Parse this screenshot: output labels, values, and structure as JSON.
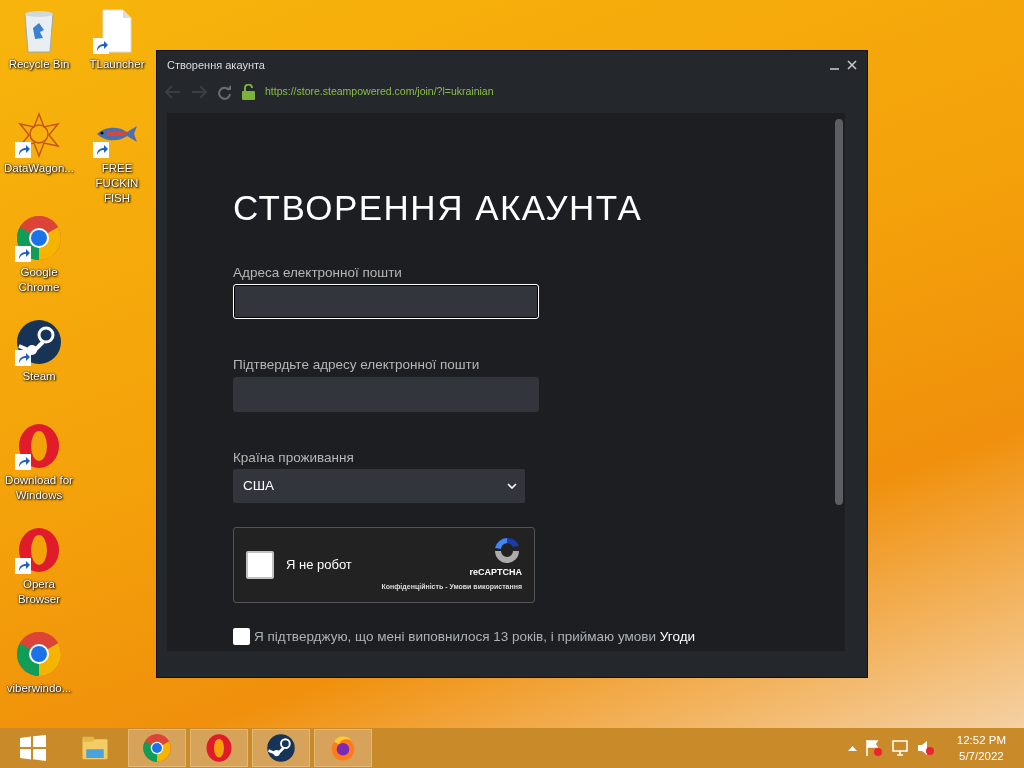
{
  "desktop_columns": [
    [
      {
        "label": "Recycle Bin",
        "kind": "recycle",
        "shortcut": false
      },
      {
        "label": "DataWagon...",
        "kind": "star",
        "shortcut": true
      },
      {
        "label": "Google Chrome",
        "kind": "chrome",
        "shortcut": true
      },
      {
        "label": "Steam",
        "kind": "steam",
        "shortcut": true
      },
      {
        "label": "Download for Windows",
        "kind": "opera",
        "shortcut": true
      },
      {
        "label": "Opera Browser",
        "kind": "opera",
        "shortcut": true
      },
      {
        "label": "viberwindo...",
        "kind": "chrome",
        "shortcut": false
      }
    ],
    [
      {
        "label": "TLauncher",
        "kind": "file",
        "shortcut": true
      },
      {
        "label": "FREE FUCKIN FISH",
        "kind": "fish",
        "shortcut": true
      }
    ]
  ],
  "window": {
    "title": "Створення акаунта",
    "url": "https://store.steampowered.com/join/?l=ukrainian",
    "heading": "СТВОРЕННЯ АКАУНТА",
    "fields": [
      {
        "label": "Адреса електронної пошти",
        "kind": "text",
        "focused": true
      },
      {
        "label": "Підтвердьте адресу електронної пошти",
        "kind": "text",
        "focused": false
      },
      {
        "label": "Країна проживання",
        "kind": "select",
        "value": "США"
      }
    ],
    "captcha": {
      "label": "Я не робот",
      "checked": false,
      "brand": "reCAPTCHA",
      "links": "Конфіденційність - Умови використання"
    },
    "agreement": {
      "text": "Я підтверджую, що мені виповнилося 13 років, і приймаю умови **Угоди**",
      "checked": false
    }
  },
  "taskbar": {
    "apps": [
      {
        "kind": "explorer",
        "running": false
      },
      {
        "kind": "chrome",
        "running": true
      },
      {
        "kind": "opera",
        "running": true
      },
      {
        "kind": "steam",
        "running": true
      },
      {
        "kind": "firefox",
        "running": true
      }
    ],
    "time": "12:52 PM",
    "date": "5/7/2022"
  }
}
